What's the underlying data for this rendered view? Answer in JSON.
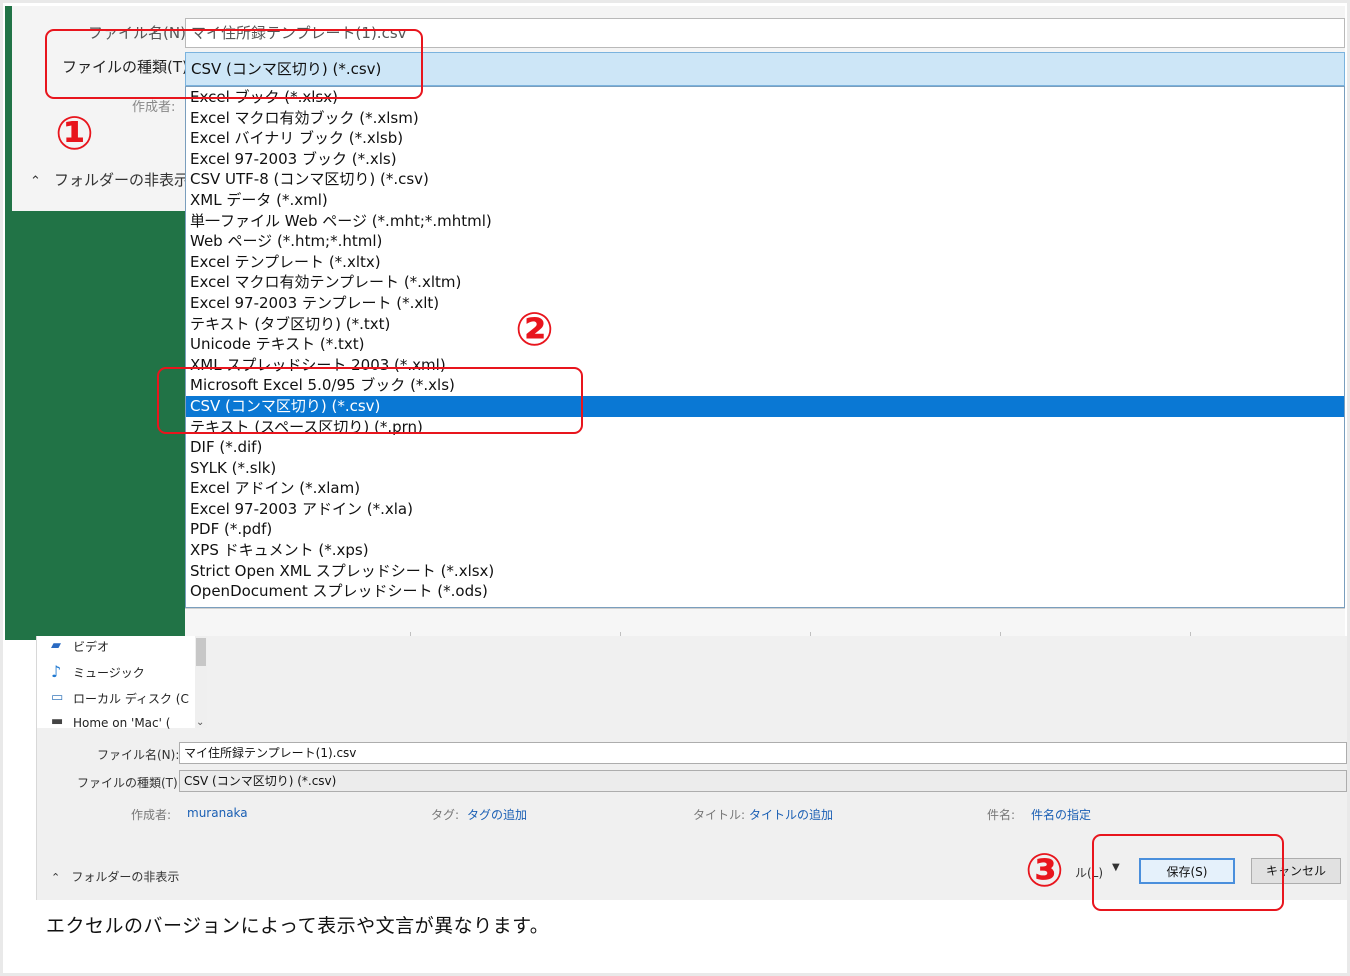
{
  "top": {
    "filename_label": "ファイル名(N):",
    "filename_value": "マイ住所録テンプレート(1).csv",
    "filetype_label": "ファイルの種類(T):",
    "filetype_value": "CSV (コンマ区切り) (*.csv)",
    "author_label": "作成者:",
    "hide_folders": "フォルダーの非表示",
    "options": [
      "Excel ブック (*.xlsx)",
      "Excel マクロ有効ブック (*.xlsm)",
      "Excel バイナリ ブック (*.xlsb)",
      "Excel 97-2003 ブック (*.xls)",
      "CSV UTF-8 (コンマ区切り) (*.csv)",
      "XML データ (*.xml)",
      "単一ファイル Web ページ (*.mht;*.mhtml)",
      "Web ページ (*.htm;*.html)",
      "Excel テンプレート (*.xltx)",
      "Excel マクロ有効テンプレート (*.xltm)",
      "Excel 97-2003 テンプレート (*.xlt)",
      "テキスト (タブ区切り) (*.txt)",
      "Unicode テキスト (*.txt)",
      "XML スプレッドシート 2003 (*.xml)",
      "Microsoft Excel 5.0/95 ブック (*.xls)",
      "CSV (コンマ区切り) (*.csv)",
      "テキスト (スペース区切り) (*.prn)",
      "DIF (*.dif)",
      "SYLK (*.slk)",
      "Excel アドイン (*.xlam)",
      "Excel 97-2003 アドイン (*.xla)",
      "PDF (*.pdf)",
      "XPS ドキュメント (*.xps)",
      "Strict Open XML スプレッドシート (*.xlsx)",
      "OpenDocument スプレッドシート (*.ods)"
    ],
    "selected_index": 15
  },
  "bottom": {
    "nav_items": [
      {
        "label": "ビデオ",
        "icon": "video-icon"
      },
      {
        "label": "ミュージック",
        "icon": "music-icon"
      },
      {
        "label": "ローカル ディスク (C",
        "icon": "disk-icon"
      },
      {
        "label": "Home on 'Mac' (",
        "icon": "network-drive-icon"
      }
    ],
    "filename_label": "ファイル名(N):",
    "filename_value": "マイ住所録テンプレート(1).csv",
    "filetype_label": "ファイルの種類(T):",
    "filetype_value": "CSV (コンマ区切り) (*.csv)",
    "author_label": "作成者:",
    "author_value": "muranaka",
    "tag_label": "タグ:",
    "tag_value": "タグの追加",
    "title_label": "タイトル:",
    "title_value": "タイトルの追加",
    "subject_label": "件名:",
    "subject_value": "件名の指定",
    "hide_folders": "フォルダーの非表示",
    "tools_label": "ル(L)",
    "save_button": "保存(S)",
    "cancel_button": "キャンセル"
  },
  "annotations": {
    "step1": "①",
    "step2": "②",
    "step3": "③"
  },
  "caption": "エクセルのバージョンによって表示や文言が異なります。",
  "colors": {
    "excel_green": "#217346",
    "annotation_red": "#e8151d",
    "selection_blue": "#0a78d4",
    "link_blue": "#1a5fb4"
  }
}
